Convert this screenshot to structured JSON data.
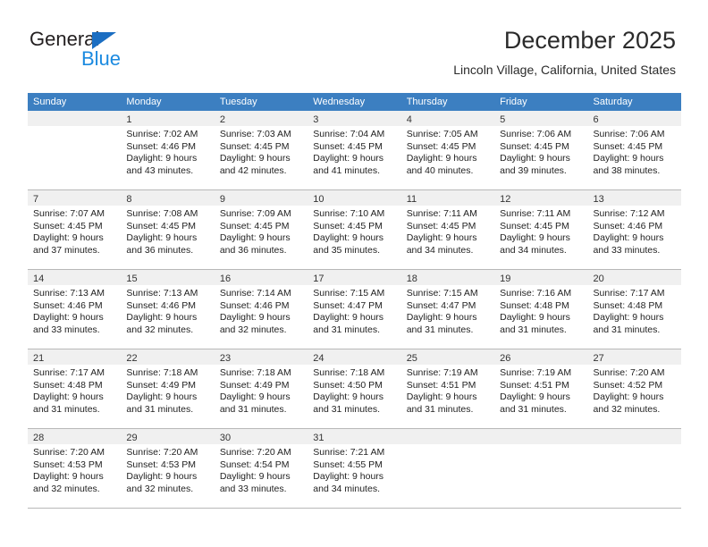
{
  "brand": {
    "name_part1": "General",
    "name_part2": "Blue",
    "triangle_color": "#1b6ec2",
    "blue_text_color": "#1b8ae0"
  },
  "header": {
    "title": "December 2025",
    "subtitle": "Lincoln Village, California, United States"
  },
  "colors": {
    "header_row_background": "#3c7fc1",
    "header_row_text": "#ffffff",
    "day_band_background": "#f0f0f0",
    "grid_line": "#b8b8b8",
    "body_text": "#222222"
  },
  "weekdays": [
    "Sunday",
    "Monday",
    "Tuesday",
    "Wednesday",
    "Thursday",
    "Friday",
    "Saturday"
  ],
  "weeks": [
    [
      {
        "day": "",
        "sunrise": "",
        "sunset": "",
        "daylight_line1": "",
        "daylight_line2": ""
      },
      {
        "day": "1",
        "sunrise": "Sunrise: 7:02 AM",
        "sunset": "Sunset: 4:46 PM",
        "daylight_line1": "Daylight: 9 hours",
        "daylight_line2": "and 43 minutes."
      },
      {
        "day": "2",
        "sunrise": "Sunrise: 7:03 AM",
        "sunset": "Sunset: 4:45 PM",
        "daylight_line1": "Daylight: 9 hours",
        "daylight_line2": "and 42 minutes."
      },
      {
        "day": "3",
        "sunrise": "Sunrise: 7:04 AM",
        "sunset": "Sunset: 4:45 PM",
        "daylight_line1": "Daylight: 9 hours",
        "daylight_line2": "and 41 minutes."
      },
      {
        "day": "4",
        "sunrise": "Sunrise: 7:05 AM",
        "sunset": "Sunset: 4:45 PM",
        "daylight_line1": "Daylight: 9 hours",
        "daylight_line2": "and 40 minutes."
      },
      {
        "day": "5",
        "sunrise": "Sunrise: 7:06 AM",
        "sunset": "Sunset: 4:45 PM",
        "daylight_line1": "Daylight: 9 hours",
        "daylight_line2": "and 39 minutes."
      },
      {
        "day": "6",
        "sunrise": "Sunrise: 7:06 AM",
        "sunset": "Sunset: 4:45 PM",
        "daylight_line1": "Daylight: 9 hours",
        "daylight_line2": "and 38 minutes."
      }
    ],
    [
      {
        "day": "7",
        "sunrise": "Sunrise: 7:07 AM",
        "sunset": "Sunset: 4:45 PM",
        "daylight_line1": "Daylight: 9 hours",
        "daylight_line2": "and 37 minutes."
      },
      {
        "day": "8",
        "sunrise": "Sunrise: 7:08 AM",
        "sunset": "Sunset: 4:45 PM",
        "daylight_line1": "Daylight: 9 hours",
        "daylight_line2": "and 36 minutes."
      },
      {
        "day": "9",
        "sunrise": "Sunrise: 7:09 AM",
        "sunset": "Sunset: 4:45 PM",
        "daylight_line1": "Daylight: 9 hours",
        "daylight_line2": "and 36 minutes."
      },
      {
        "day": "10",
        "sunrise": "Sunrise: 7:10 AM",
        "sunset": "Sunset: 4:45 PM",
        "daylight_line1": "Daylight: 9 hours",
        "daylight_line2": "and 35 minutes."
      },
      {
        "day": "11",
        "sunrise": "Sunrise: 7:11 AM",
        "sunset": "Sunset: 4:45 PM",
        "daylight_line1": "Daylight: 9 hours",
        "daylight_line2": "and 34 minutes."
      },
      {
        "day": "12",
        "sunrise": "Sunrise: 7:11 AM",
        "sunset": "Sunset: 4:45 PM",
        "daylight_line1": "Daylight: 9 hours",
        "daylight_line2": "and 34 minutes."
      },
      {
        "day": "13",
        "sunrise": "Sunrise: 7:12 AM",
        "sunset": "Sunset: 4:46 PM",
        "daylight_line1": "Daylight: 9 hours",
        "daylight_line2": "and 33 minutes."
      }
    ],
    [
      {
        "day": "14",
        "sunrise": "Sunrise: 7:13 AM",
        "sunset": "Sunset: 4:46 PM",
        "daylight_line1": "Daylight: 9 hours",
        "daylight_line2": "and 33 minutes."
      },
      {
        "day": "15",
        "sunrise": "Sunrise: 7:13 AM",
        "sunset": "Sunset: 4:46 PM",
        "daylight_line1": "Daylight: 9 hours",
        "daylight_line2": "and 32 minutes."
      },
      {
        "day": "16",
        "sunrise": "Sunrise: 7:14 AM",
        "sunset": "Sunset: 4:46 PM",
        "daylight_line1": "Daylight: 9 hours",
        "daylight_line2": "and 32 minutes."
      },
      {
        "day": "17",
        "sunrise": "Sunrise: 7:15 AM",
        "sunset": "Sunset: 4:47 PM",
        "daylight_line1": "Daylight: 9 hours",
        "daylight_line2": "and 31 minutes."
      },
      {
        "day": "18",
        "sunrise": "Sunrise: 7:15 AM",
        "sunset": "Sunset: 4:47 PM",
        "daylight_line1": "Daylight: 9 hours",
        "daylight_line2": "and 31 minutes."
      },
      {
        "day": "19",
        "sunrise": "Sunrise: 7:16 AM",
        "sunset": "Sunset: 4:48 PM",
        "daylight_line1": "Daylight: 9 hours",
        "daylight_line2": "and 31 minutes."
      },
      {
        "day": "20",
        "sunrise": "Sunrise: 7:17 AM",
        "sunset": "Sunset: 4:48 PM",
        "daylight_line1": "Daylight: 9 hours",
        "daylight_line2": "and 31 minutes."
      }
    ],
    [
      {
        "day": "21",
        "sunrise": "Sunrise: 7:17 AM",
        "sunset": "Sunset: 4:48 PM",
        "daylight_line1": "Daylight: 9 hours",
        "daylight_line2": "and 31 minutes."
      },
      {
        "day": "22",
        "sunrise": "Sunrise: 7:18 AM",
        "sunset": "Sunset: 4:49 PM",
        "daylight_line1": "Daylight: 9 hours",
        "daylight_line2": "and 31 minutes."
      },
      {
        "day": "23",
        "sunrise": "Sunrise: 7:18 AM",
        "sunset": "Sunset: 4:49 PM",
        "daylight_line1": "Daylight: 9 hours",
        "daylight_line2": "and 31 minutes."
      },
      {
        "day": "24",
        "sunrise": "Sunrise: 7:18 AM",
        "sunset": "Sunset: 4:50 PM",
        "daylight_line1": "Daylight: 9 hours",
        "daylight_line2": "and 31 minutes."
      },
      {
        "day": "25",
        "sunrise": "Sunrise: 7:19 AM",
        "sunset": "Sunset: 4:51 PM",
        "daylight_line1": "Daylight: 9 hours",
        "daylight_line2": "and 31 minutes."
      },
      {
        "day": "26",
        "sunrise": "Sunrise: 7:19 AM",
        "sunset": "Sunset: 4:51 PM",
        "daylight_line1": "Daylight: 9 hours",
        "daylight_line2": "and 31 minutes."
      },
      {
        "day": "27",
        "sunrise": "Sunrise: 7:20 AM",
        "sunset": "Sunset: 4:52 PM",
        "daylight_line1": "Daylight: 9 hours",
        "daylight_line2": "and 32 minutes."
      }
    ],
    [
      {
        "day": "28",
        "sunrise": "Sunrise: 7:20 AM",
        "sunset": "Sunset: 4:53 PM",
        "daylight_line1": "Daylight: 9 hours",
        "daylight_line2": "and 32 minutes."
      },
      {
        "day": "29",
        "sunrise": "Sunrise: 7:20 AM",
        "sunset": "Sunset: 4:53 PM",
        "daylight_line1": "Daylight: 9 hours",
        "daylight_line2": "and 32 minutes."
      },
      {
        "day": "30",
        "sunrise": "Sunrise: 7:20 AM",
        "sunset": "Sunset: 4:54 PM",
        "daylight_line1": "Daylight: 9 hours",
        "daylight_line2": "and 33 minutes."
      },
      {
        "day": "31",
        "sunrise": "Sunrise: 7:21 AM",
        "sunset": "Sunset: 4:55 PM",
        "daylight_line1": "Daylight: 9 hours",
        "daylight_line2": "and 34 minutes."
      },
      {
        "day": "",
        "sunrise": "",
        "sunset": "",
        "daylight_line1": "",
        "daylight_line2": ""
      },
      {
        "day": "",
        "sunrise": "",
        "sunset": "",
        "daylight_line1": "",
        "daylight_line2": ""
      },
      {
        "day": "",
        "sunrise": "",
        "sunset": "",
        "daylight_line1": "",
        "daylight_line2": ""
      }
    ]
  ]
}
